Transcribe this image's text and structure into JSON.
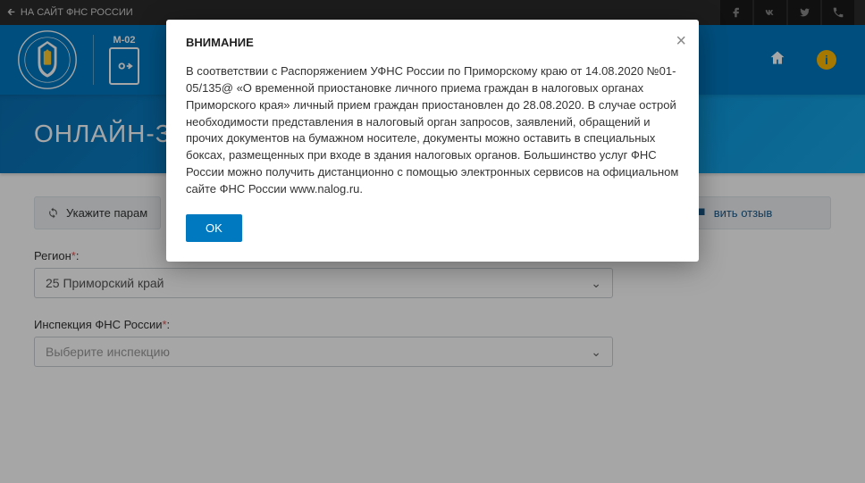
{
  "topbar": {
    "back_label": "НА САЙТ ФНС РОССИИ"
  },
  "header": {
    "service_code": "M-02"
  },
  "banner": {
    "title": "ОНЛАЙН-З"
  },
  "panel": {
    "step_label": "Укажите парам",
    "review_label": "вить отзыв"
  },
  "form": {
    "region": {
      "label": "Регион",
      "required_mark": "*",
      "colon": ":",
      "value": "25 Приморский край"
    },
    "inspection": {
      "label": "Инспекция ФНС России",
      "required_mark": "*",
      "colon": ":",
      "placeholder": "Выберите инспекцию"
    }
  },
  "modal": {
    "title": "ВНИМАНИЕ",
    "body": "В соответствии с Распоряжением УФНС России по Приморскому краю от 14.08.2020 №01-05/135@ «О временной приостановке личного приема граждан в налоговых органах Приморского края» личный прием граждан приостановлен до 28.08.2020. В случае острой необходимости представления в налоговый орган запросов, заявлений, обращений и прочих документов на бумажном носителе, документы можно оставить в специальных боксах, размещенных при входе в здания налоговых органов. Большинство услуг ФНС России можно получить дистанционно с помощью электронных сервисов на официальном сайте ФНС России www.nalog.ru.",
    "ok_label": "OK"
  }
}
